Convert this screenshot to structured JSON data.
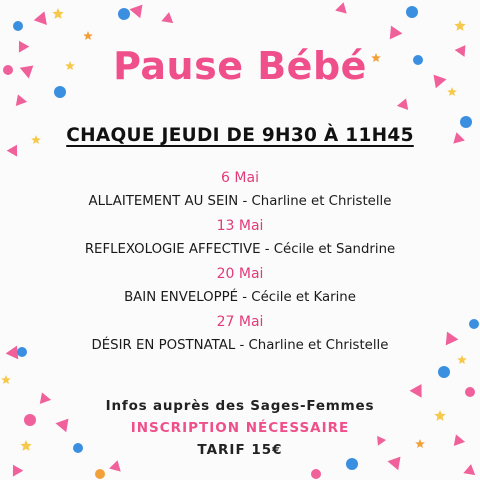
{
  "title": "Pause Bébé",
  "subtitle": "CHAQUE JEUDI DE 9H30 À 11H45",
  "sessions": [
    {
      "date": "6 Mai",
      "activity": "ALLAITEMENT AU SEIN - Charline et Christelle"
    },
    {
      "date": "13 Mai",
      "activity": "REFLEXOLOGIE AFFECTIVE - Cécile et Sandrine"
    },
    {
      "date": "20 Mai",
      "activity": "BAIN ENVELOPPÉ - Cécile et Karine"
    },
    {
      "date": "27 Mai",
      "activity": "DÉSIR EN POSTNATAL - Charline et Christelle"
    }
  ],
  "footer": {
    "info": "Infos auprès des Sages-Femmes",
    "registration": "INSCRIPTION NÉCESSAIRE",
    "price": "TARIF 15€"
  },
  "colors": {
    "accent": "#ef4f8b",
    "date": "#e23b7a",
    "confetti_pink": "#f0609a",
    "confetti_blue": "#3b8fe0",
    "confetti_yellow": "#f6c94a",
    "confetti_orange": "#f2a13a"
  }
}
